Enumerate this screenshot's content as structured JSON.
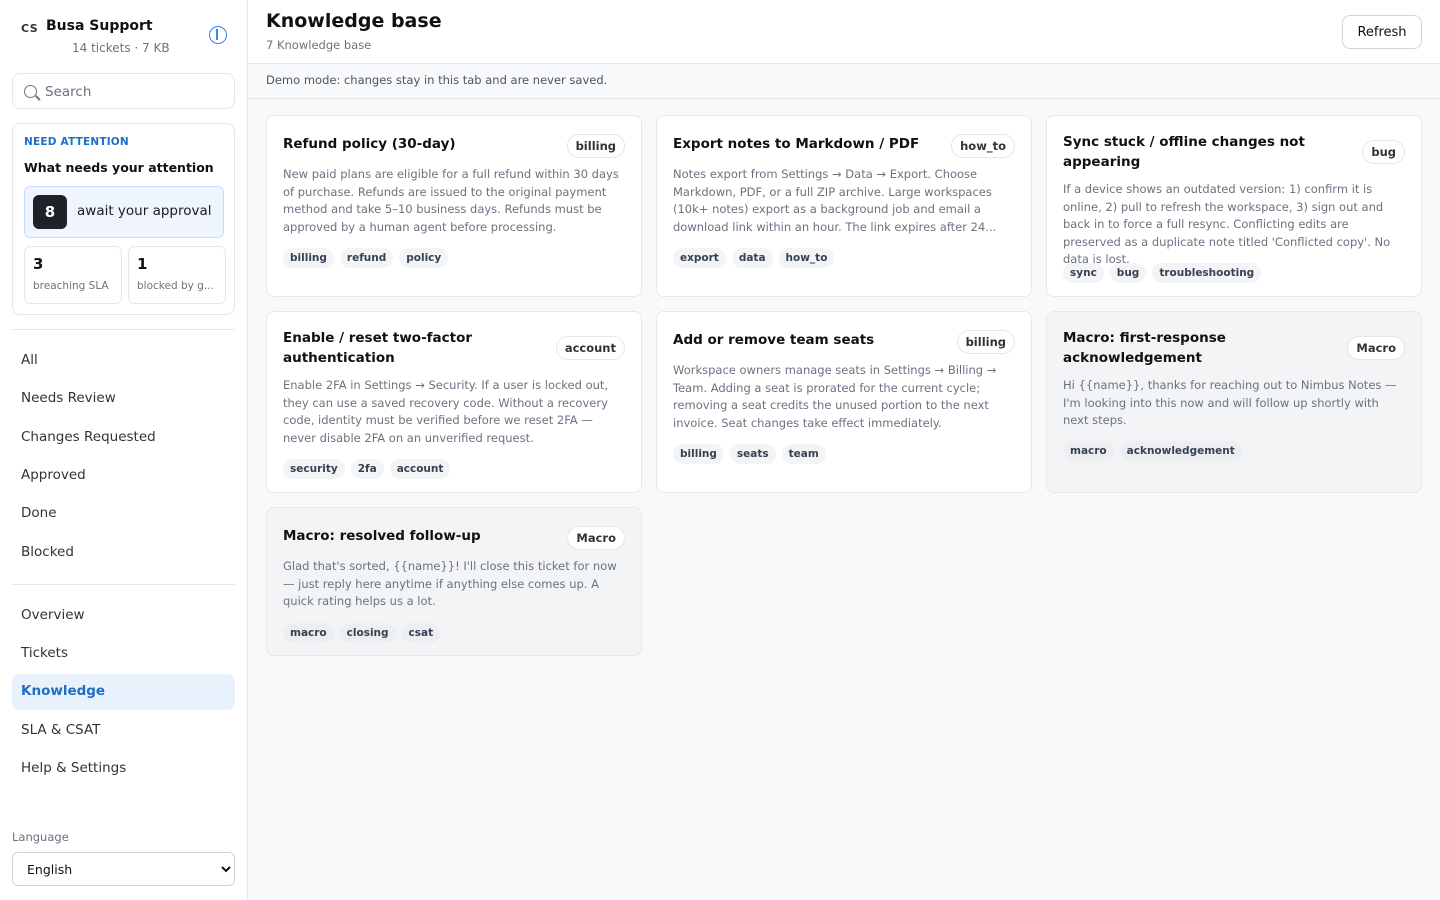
{
  "brand": {
    "logo": "CS",
    "name": "Busa Support",
    "sub": "14 tickets · 7 KB"
  },
  "search": {
    "placeholder": "Search"
  },
  "attention": {
    "kicker": "NEED ATTENTION",
    "title": "What needs your attention",
    "approval_count": "8",
    "approval_label": "await your approval",
    "stats": [
      {
        "num": "3",
        "label": "breaching SLA"
      },
      {
        "num": "1",
        "label": "blocked by g..."
      }
    ]
  },
  "nav_filters": [
    "All",
    "Needs Review",
    "Changes Requested",
    "Approved",
    "Done",
    "Blocked"
  ],
  "nav_pages": [
    "Overview",
    "Tickets",
    "Knowledge",
    "SLA & CSAT",
    "Help & Settings"
  ],
  "active_page": "Knowledge",
  "language": {
    "label": "Language",
    "selected": "English"
  },
  "header": {
    "title": "Knowledge base",
    "sub": "7 Knowledge base",
    "refresh": "Refresh"
  },
  "demo_notice": "Demo mode: changes stay in this tab and are never saved.",
  "articles": [
    {
      "title": "Refund policy (30-day)",
      "badge": "billing",
      "body": "New paid plans are eligible for a full refund within 30 days of purchase. Refunds are issued to the original payment method and take 5–10 business days. Refunds must be approved by a human agent before processing.",
      "tags": [
        "billing",
        "refund",
        "policy"
      ]
    },
    {
      "title": "Export notes to Markdown / PDF",
      "badge": "how_to",
      "body": "Notes export from Settings → Data → Export. Choose Markdown, PDF, or a full ZIP archive. Large workspaces (10k+ notes) export as a background job and email a download link within an hour. The link expires after 24...",
      "tags": [
        "export",
        "data",
        "how_to"
      ]
    },
    {
      "title": "Sync stuck / offline changes not appearing",
      "badge": "bug",
      "body": "If a device shows an outdated version: 1) confirm it is online, 2) pull to refresh the workspace, 3) sign out and back in to force a full resync. Conflicting edits are preserved as a duplicate note titled 'Conflicted copy'. No data is lost.",
      "tags": [
        "sync",
        "bug",
        "troubleshooting"
      ]
    },
    {
      "title": "Enable / reset two-factor authentication",
      "badge": "account",
      "body": "Enable 2FA in Settings → Security. If a user is locked out, they can use a saved recovery code. Without a recovery code, identity must be verified before we reset 2FA — never disable 2FA on an unverified request.",
      "tags": [
        "security",
        "2fa",
        "account"
      ]
    },
    {
      "title": "Add or remove team seats",
      "badge": "billing",
      "body": "Workspace owners manage seats in Settings → Billing → Team. Adding a seat is prorated for the current cycle; removing a seat credits the unused portion to the next invoice. Seat changes take effect immediately.",
      "tags": [
        "billing",
        "seats",
        "team"
      ]
    },
    {
      "title": "Macro: first-response acknowledgement",
      "badge": "Macro",
      "body": "Hi {{name}}, thanks for reaching out to Nimbus Notes — I'm looking into this now and will follow up shortly with next steps.",
      "tags": [
        "macro",
        "acknowledgement"
      ]
    },
    {
      "title": "Macro: resolved follow-up",
      "badge": "Macro",
      "body": "Glad that's sorted, {{name}}! I'll close this ticket for now — just reply here anytime if anything else comes up. A quick rating helps us a lot.",
      "tags": [
        "macro",
        "closing",
        "csat"
      ]
    }
  ]
}
